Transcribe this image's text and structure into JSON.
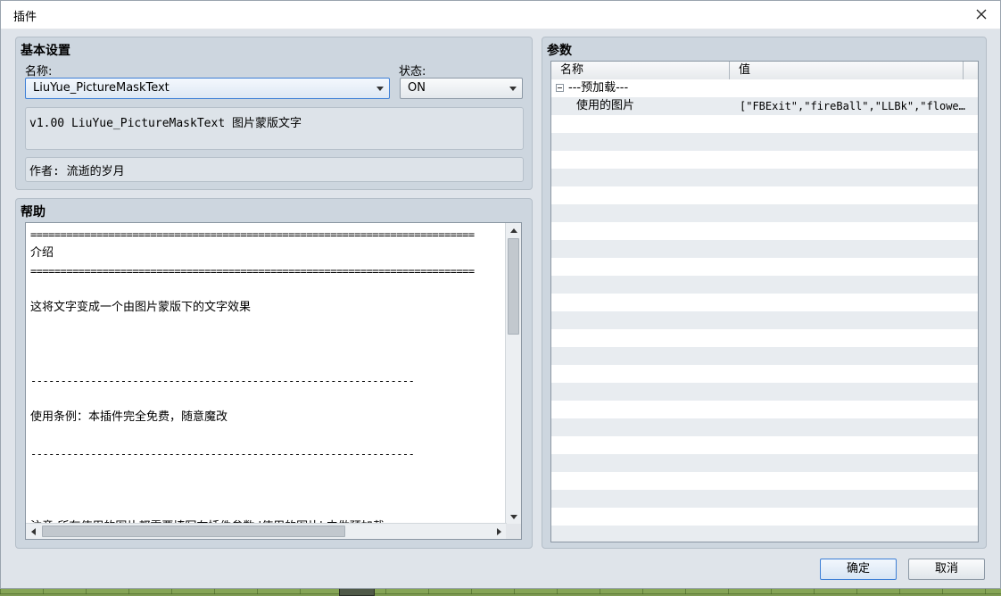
{
  "window": {
    "title": "插件"
  },
  "basic": {
    "section_title": "基本设置",
    "name_label": "名称:",
    "name_value": "LiuYue_PictureMaskText",
    "status_label": "状态:",
    "status_value": "ON",
    "description": "v1.00 LiuYue_PictureMaskText 图片蒙版文字",
    "author": "作者: 流逝的岁月"
  },
  "help": {
    "section_title": "帮助",
    "lines": [
      "==========================================================================",
      "介绍",
      "==========================================================================",
      "",
      "这将文字变成一个由图片蒙版下的文字效果",
      "",
      "",
      "",
      "----------------------------------------------------------------",
      "",
      "使用条例：本插件完全免费，随意魔改",
      "",
      "----------------------------------------------------------------",
      "",
      "",
      "",
      "注意:所有使用的图片都需要填写在插件参数 '使用的图片' 中做预加载"
    ]
  },
  "params": {
    "section_title": "参数",
    "col_name": "名称",
    "col_value": "值",
    "rows": [
      {
        "name": "---预加载---",
        "value": ""
      },
      {
        "name": "使用的图片",
        "value": "[\"FBExit\",\"fireBall\",\"LLBk\",\"flowe…"
      }
    ]
  },
  "buttons": {
    "ok": "确定",
    "cancel": "取消"
  },
  "colors": {
    "accent": "#3d7fd6",
    "panel": "#cdd6df",
    "window": "#dfe4ea"
  }
}
